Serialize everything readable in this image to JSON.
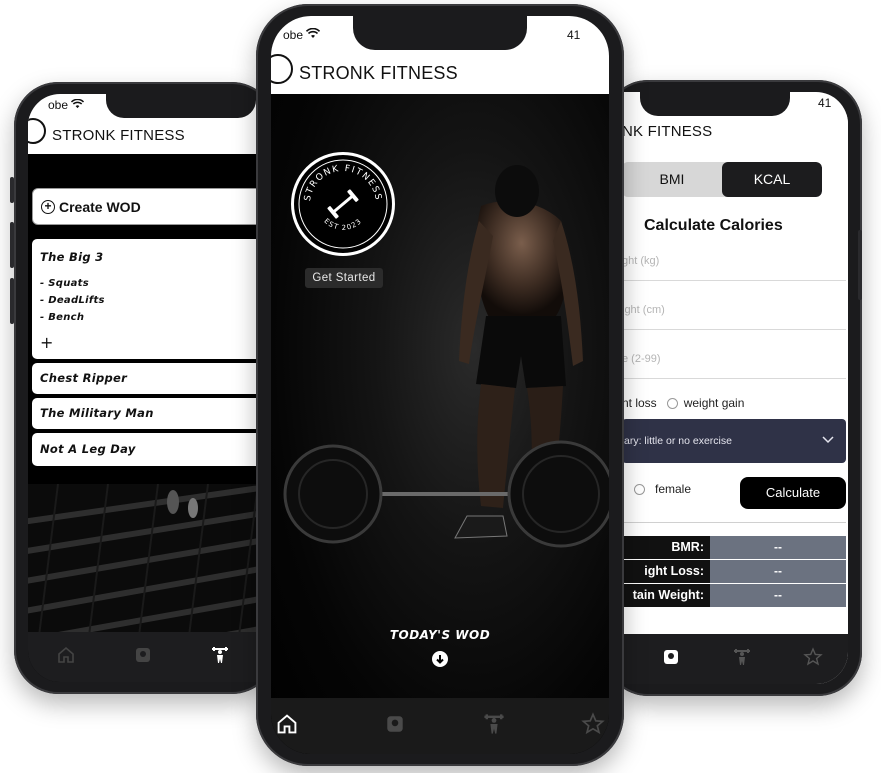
{
  "app_name": "STRONK FITNESS",
  "status": {
    "carrier_fragment": "obe",
    "battery_fragment": "41"
  },
  "left_screen": {
    "create_button": "Create WOD",
    "wods": [
      {
        "title": "The Big 3",
        "exercises": [
          "- Squats",
          "- DeadLifts",
          "- Bench"
        ],
        "add": "+"
      },
      {
        "title": "Chest Ripper"
      },
      {
        "title": "The Military Man"
      },
      {
        "title": "Not A Leg Day"
      }
    ]
  },
  "middle_screen": {
    "badge_top_text": "STRONK FITNESS",
    "badge_bottom_text": "EST 2023",
    "get_started": "Get Started",
    "todays_wod": "TODAY'S WOD"
  },
  "right_screen": {
    "header_fragment": "NK FITNESS",
    "tabs": [
      {
        "label": "BMI",
        "active": false
      },
      {
        "label": "KCAL",
        "active": true
      }
    ],
    "title": "Calculate Calories",
    "fields": [
      "ght (kg)",
      "ight (cm)",
      "e (2-99)"
    ],
    "goal_options": [
      "nt loss",
      "weight gain"
    ],
    "activity_select": "ary: little or no exercise",
    "gender_option": "female",
    "calculate_button": "Calculate",
    "results": [
      {
        "label": "BMR:",
        "value": "--"
      },
      {
        "label": "ight Loss:",
        "value": "--"
      },
      {
        "label": "tain Weight:",
        "value": "--"
      }
    ]
  },
  "tabbar_icons": [
    "home-icon",
    "scale-icon",
    "weightlifter-icon",
    "star-icon"
  ],
  "colors": {
    "accent_dark": "#1c1c1e",
    "select_bg": "#2f3247",
    "result_value_bg": "#6b7280"
  }
}
